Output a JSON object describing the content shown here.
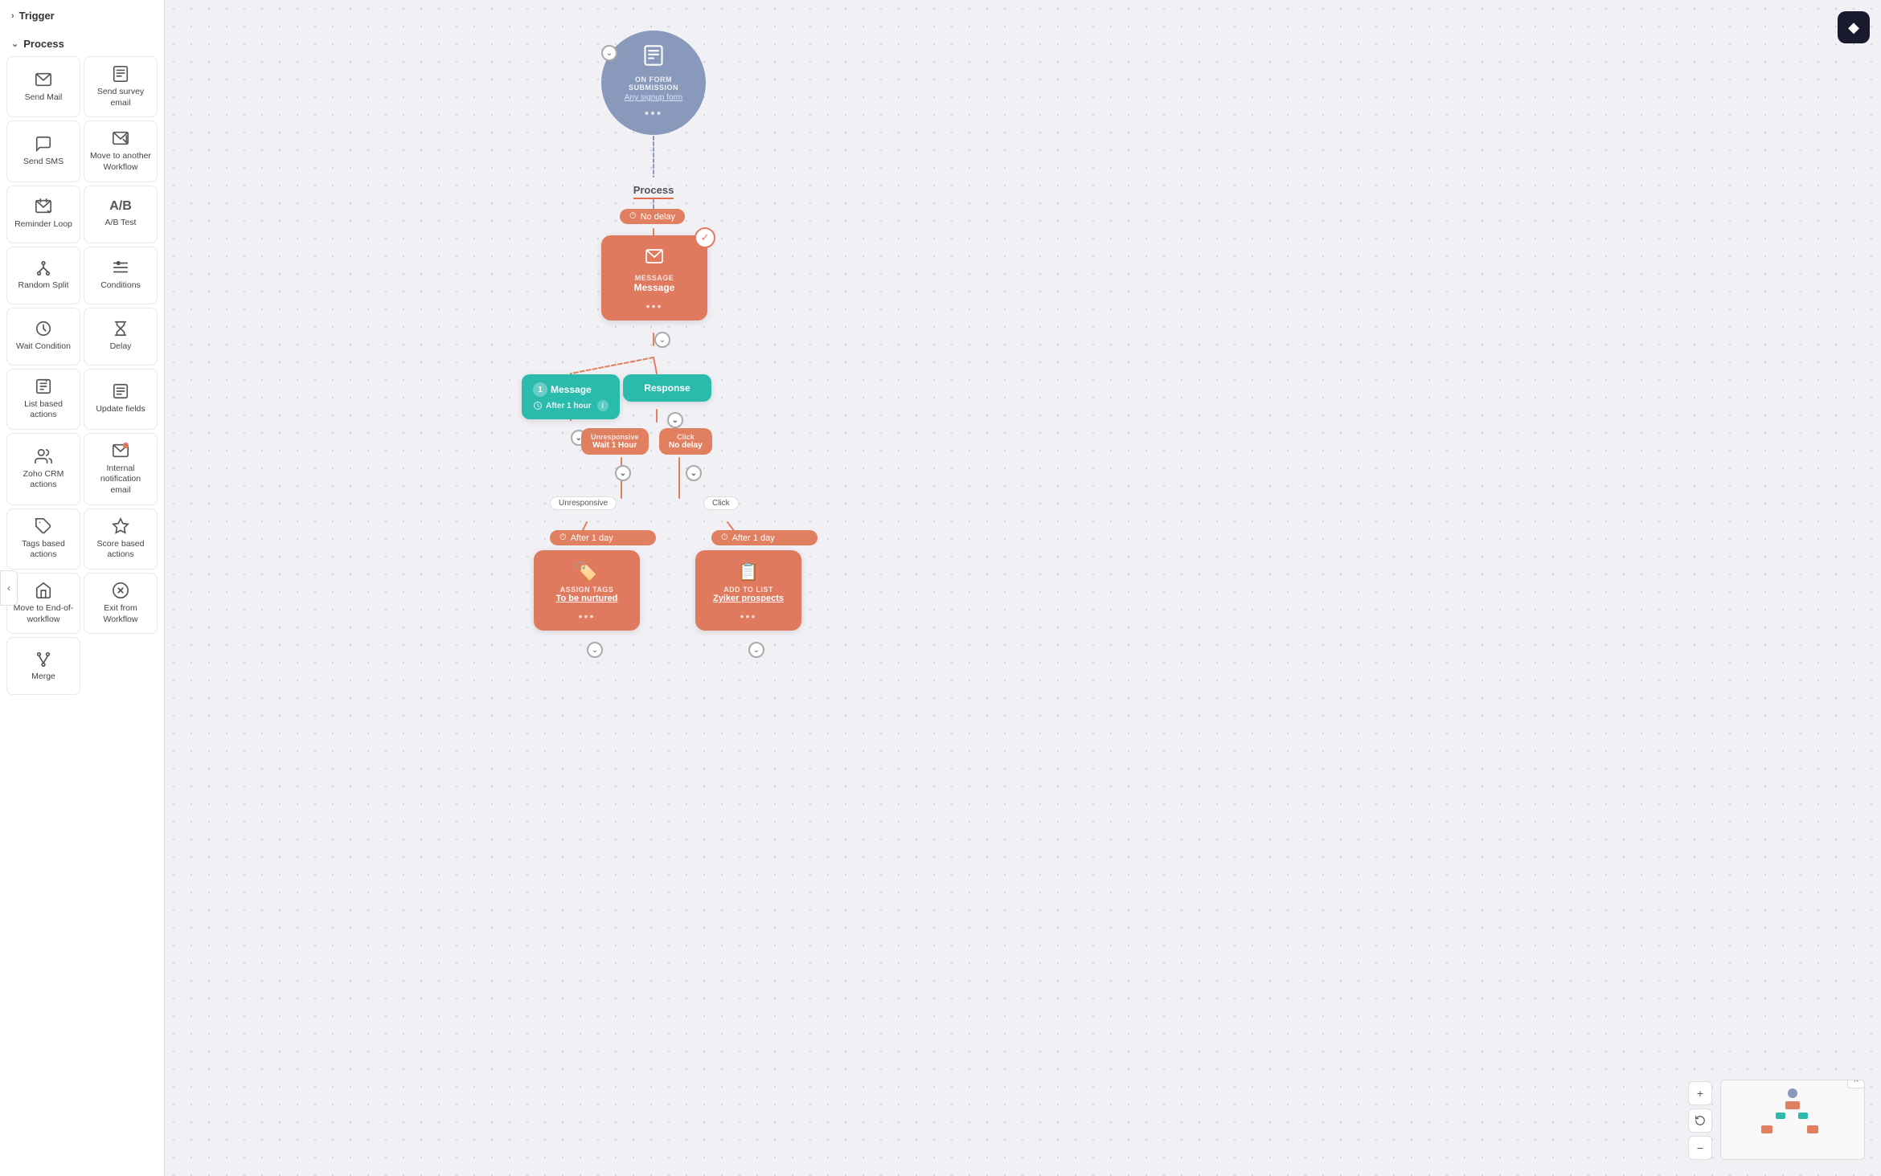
{
  "sidebar": {
    "trigger_label": "Trigger",
    "process_label": "Process",
    "items": [
      {
        "id": "send-mail",
        "label": "Send Mail",
        "icon": "✉️"
      },
      {
        "id": "send-survey-email",
        "label": "Send survey email",
        "icon": "📋"
      },
      {
        "id": "send-sms",
        "label": "Send SMS",
        "icon": "💬"
      },
      {
        "id": "move-workflow",
        "label": "Move to another Workflow",
        "icon": "↗️"
      },
      {
        "id": "reminder-loop",
        "label": "Reminder Loop",
        "icon": "🔁"
      },
      {
        "id": "ab-test",
        "label": "A/B Test",
        "icon": "AB"
      },
      {
        "id": "random-split",
        "label": "Random Split",
        "icon": "⑂"
      },
      {
        "id": "conditions",
        "label": "Conditions",
        "icon": "≡"
      },
      {
        "id": "wait-condition",
        "label": "Wait Condition",
        "icon": "⏳"
      },
      {
        "id": "delay",
        "label": "Delay",
        "icon": "⏱"
      },
      {
        "id": "list-based",
        "label": "List based actions",
        "icon": "📑"
      },
      {
        "id": "update-fields",
        "label": "Update fields",
        "icon": "🔧"
      },
      {
        "id": "zoho-crm",
        "label": "Zoho CRM actions",
        "icon": "🤝"
      },
      {
        "id": "internal-notification",
        "label": "Internal notification email",
        "icon": "🔔"
      },
      {
        "id": "tags-based",
        "label": "Tags based actions",
        "icon": "🏷️"
      },
      {
        "id": "score-based",
        "label": "Score based actions",
        "icon": "🏆"
      },
      {
        "id": "move-end",
        "label": "Move to End-of-workflow",
        "icon": "⤵️"
      },
      {
        "id": "exit-workflow",
        "label": "Exit from Workflow",
        "icon": "🚫"
      },
      {
        "id": "merge",
        "label": "Merge",
        "icon": "⑃"
      }
    ]
  },
  "canvas": {
    "trigger_node": {
      "title": "ON FORM SUBMISSION",
      "link": "Any signup form",
      "dots": "•••"
    },
    "process_label": "Process",
    "nodes": {
      "delay1": {
        "label": "No delay",
        "icon": "⏱"
      },
      "message_node": {
        "type": "MESSAGE",
        "name": "Message",
        "dots": "•••"
      },
      "message_condition": {
        "number": "1",
        "label": "Message",
        "sublabel": "After 1 hour",
        "info": "i"
      },
      "response_node": {
        "label": "Response"
      },
      "unresponsive_label": "Unresponsive",
      "click_label": "Click",
      "wait1hour": {
        "label": "Wait 1 Hour",
        "prefix": "Unresponsive"
      },
      "no_delay_click": {
        "label": "No delay",
        "prefix": "Click"
      },
      "unresponsive_branch": "Unresponsive",
      "click_branch": "Click",
      "assign_tags": {
        "delay": "After 1 day",
        "type": "ASSIGN TAGS",
        "name": "To be nurtured",
        "dots": "•••",
        "icon": "🏷️"
      },
      "add_to_list": {
        "delay": "After 1 day",
        "type": "ADD TO LIST",
        "name": "Zyiker prospects",
        "dots": "•••",
        "icon": "📋"
      }
    }
  },
  "controls": {
    "close_label": "×",
    "zoom_in_label": "+",
    "zoom_out_label": "−",
    "reset_label": "↺",
    "app_icon": "◆"
  }
}
